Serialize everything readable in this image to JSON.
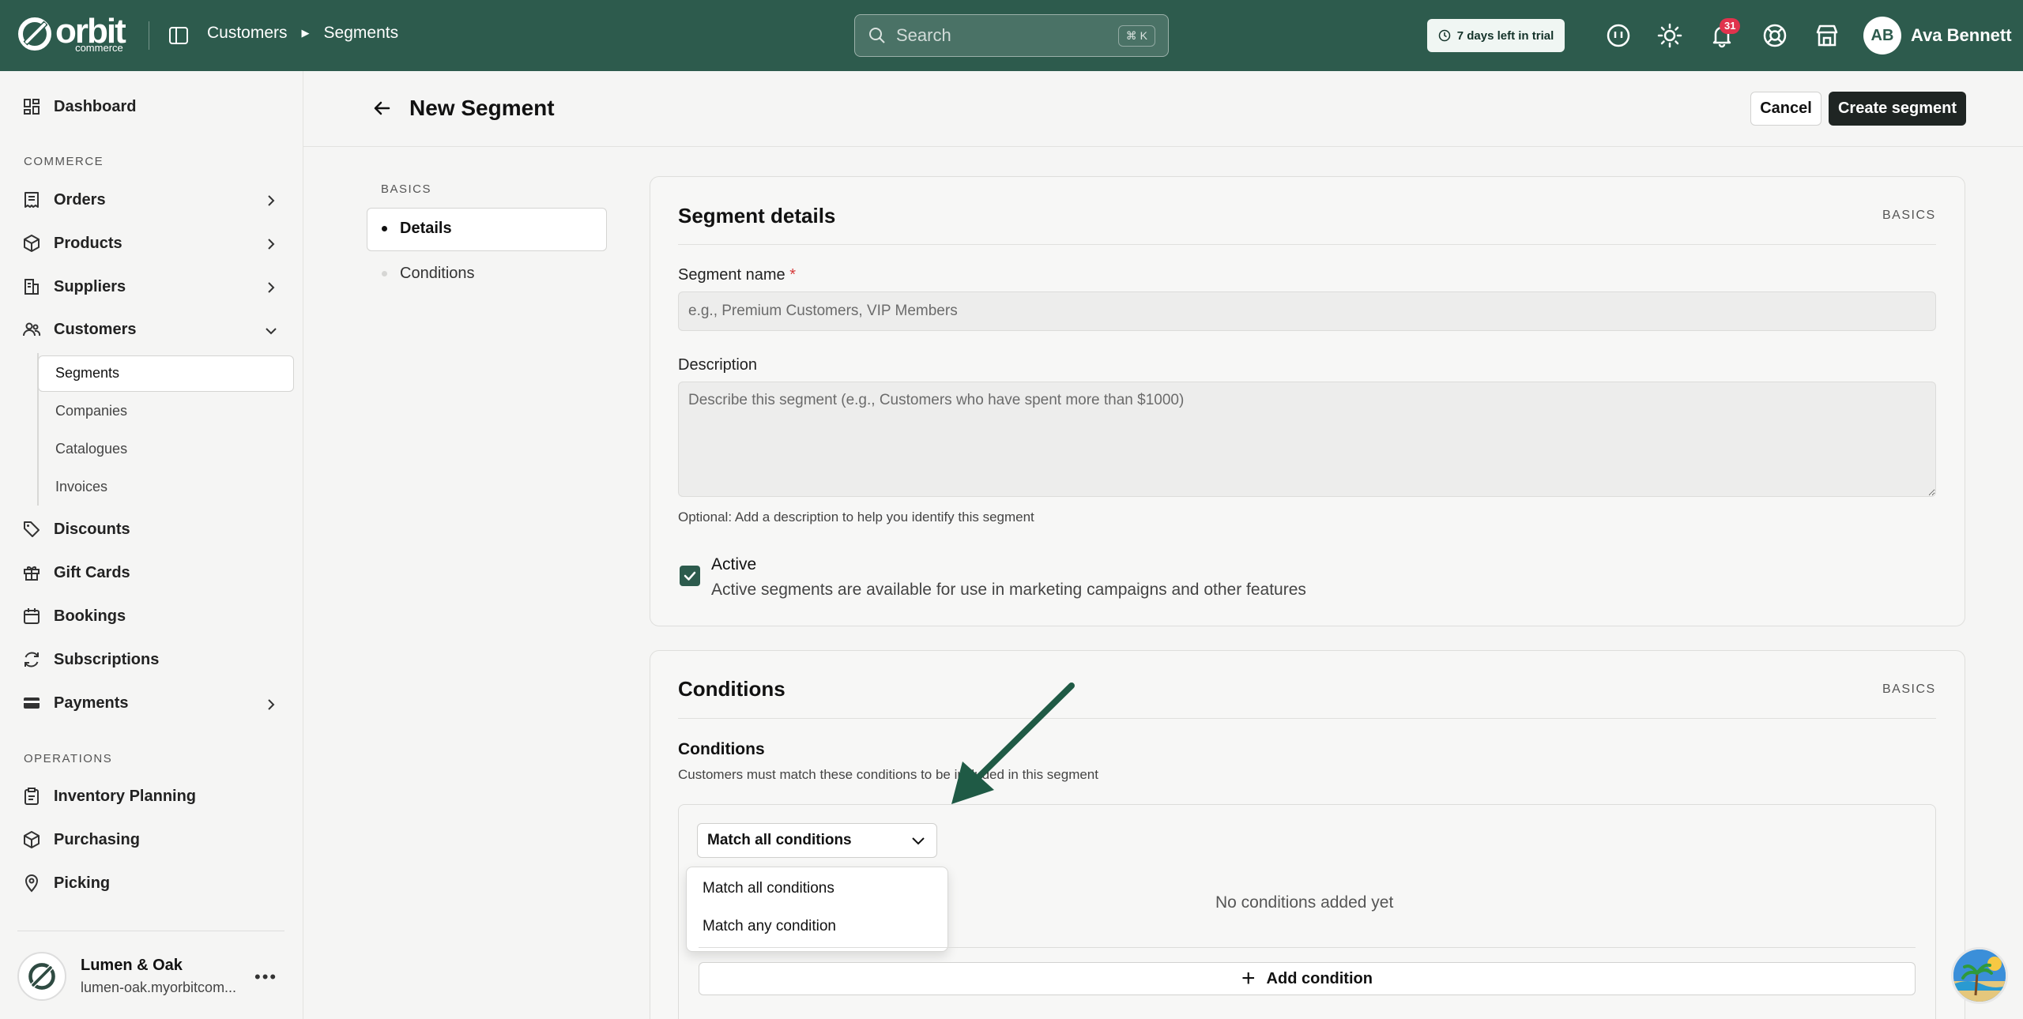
{
  "app": {
    "logo_text": "orbit",
    "logo_sub": "commerce"
  },
  "topbar": {
    "breadcrumb": [
      "Customers",
      "Segments"
    ],
    "search_placeholder": "Search",
    "search_shortcut": "⌘ K",
    "trial_text": "7 days left in trial",
    "notification_count": "31",
    "user_initials": "AB",
    "user_name": "Ava Bennett"
  },
  "sidebar": {
    "dashboard": "Dashboard",
    "commerce_label": "COMMERCE",
    "orders": "Orders",
    "products": "Products",
    "suppliers": "Suppliers",
    "customers": "Customers",
    "customers_sub": [
      "Segments",
      "Companies",
      "Catalogues",
      "Invoices"
    ],
    "discounts": "Discounts",
    "gift_cards": "Gift Cards",
    "bookings": "Bookings",
    "subscriptions": "Subscriptions",
    "payments": "Payments",
    "operations_label": "OPERATIONS",
    "inventory_planning": "Inventory Planning",
    "purchasing": "Purchasing",
    "picking": "Picking",
    "store_name": "Lumen & Oak",
    "store_url": "lumen-oak.myorbitcom..."
  },
  "page": {
    "title": "New Segment",
    "cancel_label": "Cancel",
    "create_label": "Create segment"
  },
  "toc": {
    "section": "BASICS",
    "items": [
      "Details",
      "Conditions"
    ]
  },
  "details_card": {
    "title": "Segment details",
    "tag": "BASICS",
    "name_label": "Segment name",
    "name_required": "*",
    "name_placeholder": "e.g., Premium Customers, VIP Members",
    "description_label": "Description",
    "description_placeholder": "Describe this segment (e.g., Customers who have spent more than $1000)",
    "description_help": "Optional: Add a description to help you identify this segment",
    "active_label": "Active",
    "active_desc": "Active segments are available for use in marketing campaigns and other features",
    "active_checked": true
  },
  "conditions_card": {
    "title": "Conditions",
    "tag": "BASICS",
    "label": "Conditions",
    "description": "Customers must match these conditions to be included in this segment",
    "match_selected": "Match all conditions",
    "match_options": [
      "Match all conditions",
      "Match any condition"
    ],
    "empty_text": "No conditions added yet",
    "add_label": "Add condition"
  },
  "colors": {
    "topbar": "#2d5b4d",
    "accent": "#2d5b4d",
    "annotation_arrow": "#1f5a45",
    "primary_button": "#1f2523",
    "badge": "#e0334d"
  }
}
